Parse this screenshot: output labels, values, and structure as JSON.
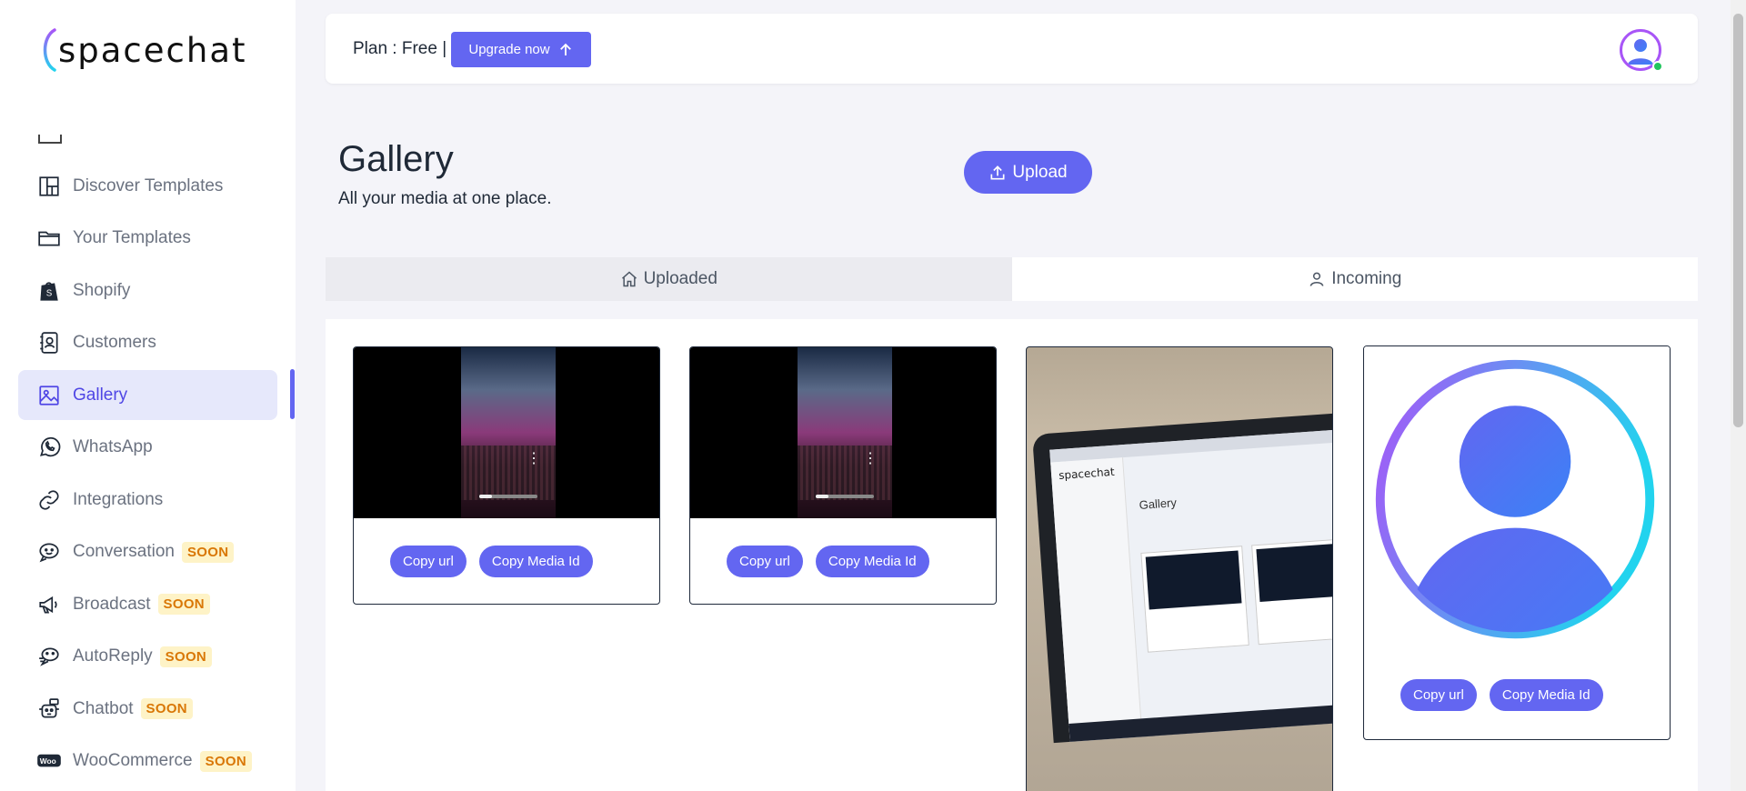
{
  "app": {
    "logo_text": "spacechat"
  },
  "sidebar": {
    "items": [
      {
        "label": "Discover Templates",
        "icon": "layout-icon",
        "soon": ""
      },
      {
        "label": "Your Templates",
        "icon": "folder-icon",
        "soon": ""
      },
      {
        "label": "Shopify",
        "icon": "shopify-icon",
        "soon": ""
      },
      {
        "label": "Customers",
        "icon": "contacts-icon",
        "soon": ""
      },
      {
        "label": "Gallery",
        "icon": "image-icon",
        "soon": "",
        "active": true
      },
      {
        "label": "WhatsApp",
        "icon": "whatsapp-icon",
        "soon": ""
      },
      {
        "label": "Integrations",
        "icon": "link-icon",
        "soon": ""
      },
      {
        "label": "Conversation",
        "icon": "chat-icon",
        "soon": "SOON"
      },
      {
        "label": "Broadcast",
        "icon": "megaphone-icon",
        "soon": "SOON"
      },
      {
        "label": "AutoReply",
        "icon": "autoreply-icon",
        "soon": "SOON"
      },
      {
        "label": "Chatbot",
        "icon": "bot-icon",
        "soon": "SOON"
      },
      {
        "label": "WooCommerce",
        "icon": "woo-icon",
        "soon": "SOON"
      }
    ]
  },
  "header": {
    "plan_text": "Plan : Free |",
    "upgrade_label": "Upgrade now"
  },
  "page": {
    "title": "Gallery",
    "subtitle": "All your media at one place.",
    "upload_label": "Upload"
  },
  "tabs": {
    "uploaded": "Uploaded",
    "incoming": "Incoming"
  },
  "media": {
    "copy_url": "Copy url",
    "copy_media_id": "Copy Media Id"
  },
  "colors": {
    "accent": "#6366f1",
    "active_bg": "#e6e8fb",
    "soon_bg": "#fef3c7",
    "soon_text": "#d97706"
  }
}
